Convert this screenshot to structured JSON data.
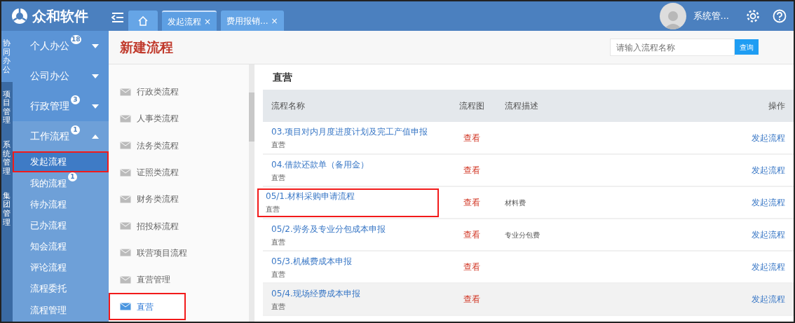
{
  "logo": {
    "text": "众和软件"
  },
  "tabs": [
    {
      "kind": "home",
      "selected": false
    },
    {
      "kind": "text",
      "label": "发起流程",
      "close": "×",
      "selected": true
    },
    {
      "kind": "text",
      "label": "费用报销...",
      "close": "×",
      "selected": false
    }
  ],
  "user": {
    "name": "系统管..."
  },
  "module_strip": [
    {
      "label": "协同办公",
      "selected": true
    },
    {
      "label": "项目管理",
      "selected": false
    },
    {
      "label": "系统管理",
      "selected": false
    },
    {
      "label": "集团管理",
      "selected": false
    }
  ],
  "sidebar": {
    "items": [
      {
        "label": "个人办公",
        "badge": "18",
        "expanded": false
      },
      {
        "label": "公司办公",
        "expanded": false
      },
      {
        "label": "行政管理",
        "badge": "3",
        "expanded": false
      },
      {
        "label": "工作流程",
        "badge": "1",
        "expanded": true,
        "children": [
          {
            "label": "发起流程",
            "selected": true,
            "highlighted": true
          },
          {
            "label": "我的流程",
            "badge": "1",
            "selected": false,
            "highlighted": false
          },
          {
            "label": "待办流程",
            "selected": false,
            "highlighted": false
          },
          {
            "label": "已办流程",
            "selected": false,
            "highlighted": false
          },
          {
            "label": "知会流程",
            "selected": false,
            "highlighted": false
          },
          {
            "label": "评论流程",
            "selected": false,
            "highlighted": false
          },
          {
            "label": "流程委托",
            "selected": false,
            "highlighted": false
          },
          {
            "label": "流程管理",
            "selected": false,
            "highlighted": false
          }
        ]
      }
    ]
  },
  "page_title": "新建流程",
  "search": {
    "placeholder": "请输入流程名称",
    "button": "查询"
  },
  "categories": [
    {
      "label": "行政类流程",
      "selected": false,
      "highlighted": false
    },
    {
      "label": "人事类流程",
      "selected": false,
      "highlighted": false
    },
    {
      "label": "法务类流程",
      "selected": false,
      "highlighted": false
    },
    {
      "label": "证照类流程",
      "selected": false,
      "highlighted": false
    },
    {
      "label": "财务类流程",
      "selected": false,
      "highlighted": false
    },
    {
      "label": "招投标流程",
      "selected": false,
      "highlighted": false
    },
    {
      "label": "联营项目流程",
      "selected": false,
      "highlighted": false
    },
    {
      "label": "直营管理",
      "selected": false,
      "highlighted": false
    },
    {
      "label": "直营",
      "selected": true,
      "highlighted": true
    }
  ],
  "panel_title": "直营",
  "table": {
    "columns": [
      "流程名称",
      "流程图",
      "流程描述",
      "操作"
    ],
    "rows": [
      {
        "name": "03.项目对内月度进度计划及完工产值申报",
        "category": "直营",
        "diagram": "查看",
        "action": "发起流程",
        "highlighted": false,
        "hovered": false
      },
      {
        "name": "04.借款还款单（备用金）",
        "category": "直营",
        "diagram": "查看",
        "action": "发起流程",
        "highlighted": false,
        "hovered": false
      },
      {
        "name": "05/1.材料采购申请流程",
        "category": "直营",
        "diagram": "查看",
        "description": "材料费",
        "action": "发起流程",
        "highlighted": true,
        "hovered": false
      },
      {
        "name": "05/2.劳务及专业分包成本申报",
        "category": "直营",
        "diagram": "查看",
        "description": "专业分包费",
        "action": "发起流程",
        "highlighted": false,
        "hovered": false
      },
      {
        "name": "05/3.机械费成本申报",
        "category": "直营",
        "diagram": "查看",
        "action": "发起流程",
        "highlighted": false,
        "hovered": false
      },
      {
        "name": "05/4.现场经费成本申报",
        "category": "直营",
        "diagram": "查看",
        "action": "发起流程",
        "highlighted": false,
        "hovered": true
      }
    ]
  }
}
